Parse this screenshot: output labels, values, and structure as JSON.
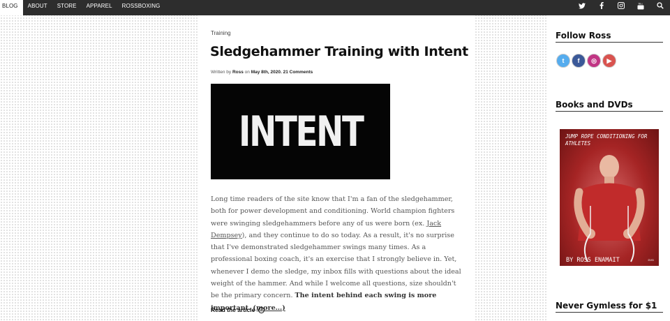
{
  "nav": {
    "items": [
      "BLOG",
      "ABOUT",
      "STORE",
      "APPAREL",
      "ROSSBOXING"
    ],
    "active": "BLOG",
    "social_icons": [
      "twitter-icon",
      "facebook-icon",
      "instagram-icon",
      "youtube-icon",
      "search-icon"
    ]
  },
  "article": {
    "category": "Training",
    "title": "Sledgehammer Training with Intent",
    "byline": {
      "prefix": "Written by",
      "author": "Ross",
      "on": "on",
      "date": "May 8th, 2020.",
      "comments": "21 Comments"
    },
    "image_text": "INTENT",
    "excerpt": {
      "part1": "Long time readers of the site know that I'm a fan of the sledgehammer, both for power development and conditioning. World champion fighters were swinging sledgehammers before any of us were born (ex. ",
      "link": "Jack Dempsey",
      "part2": "), and they continue to do so today. As a result, it's no surprise that I've demonstrated sledgehammer swings many times. As a professional boxing coach, it's an exercise that I strongly believe in. Yet, whenever I demo the sledge, my inbox fills with questions about the ideal weight of the hammer. And while I welcome all questions, size shouldn't be the primary concern. ",
      "bold": "The intent behind each swing is more important.",
      "more": "(more…)"
    },
    "read_more": "Read the article"
  },
  "sidebar": {
    "follow_title": "Follow Ross",
    "follow_icons": [
      {
        "name": "twitter",
        "glyph": "t",
        "color": "#55acee"
      },
      {
        "name": "facebook",
        "glyph": "f",
        "color": "#3b5998"
      },
      {
        "name": "instagram",
        "glyph": "◎",
        "color": "#c13584"
      },
      {
        "name": "youtube",
        "glyph": "▶",
        "color": "#d9534f"
      }
    ],
    "books_title": "Books and DVDs",
    "book": {
      "title": "JUMP ROPE CONDITIONING FOR ATHLETES",
      "author": "BY ROSS ENAMAIT",
      "badge": "DVD"
    },
    "gymless_title": "Never Gymless for $1"
  }
}
